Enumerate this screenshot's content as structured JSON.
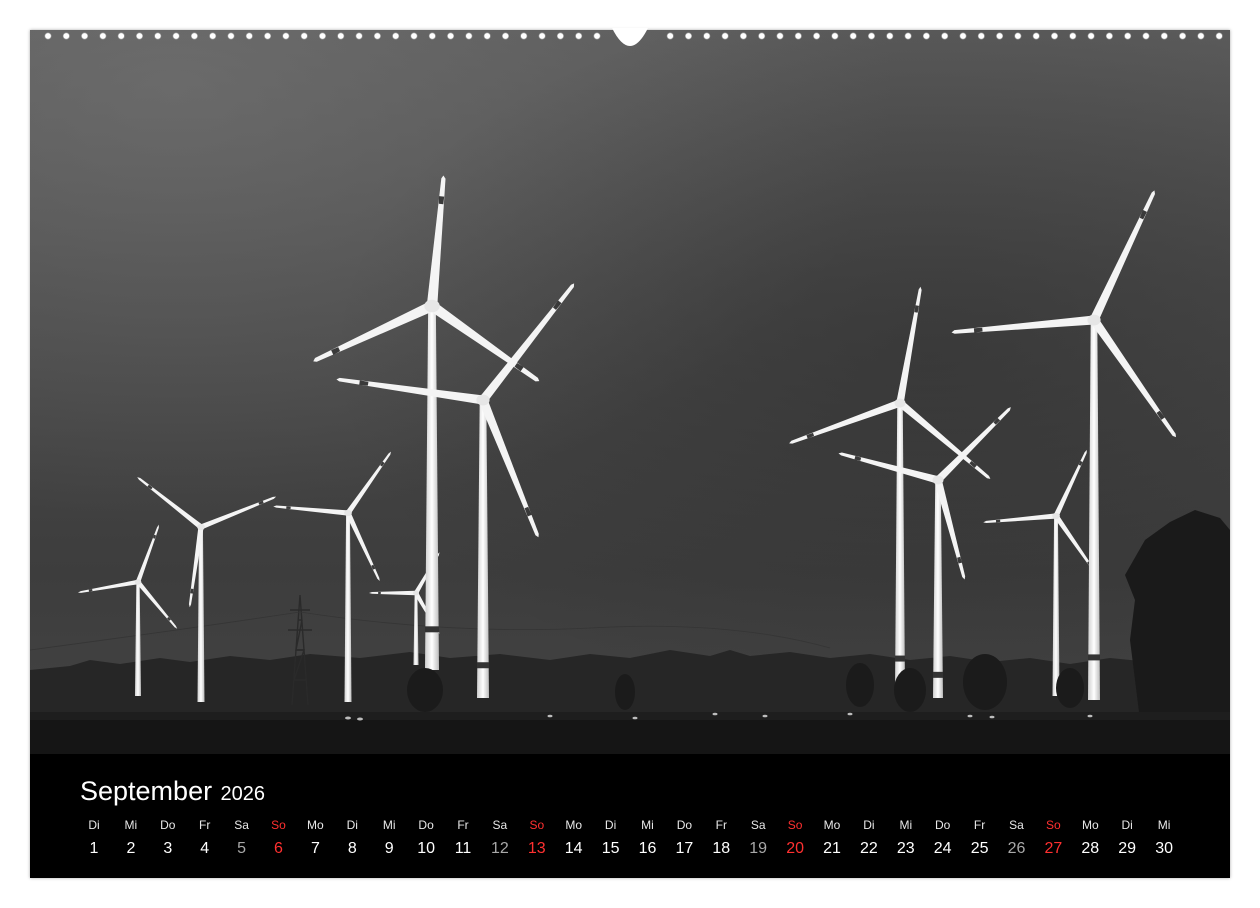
{
  "calendar": {
    "month": "September",
    "year": "2026",
    "colors": {
      "sunday": "#ff3030",
      "saturday": "#a8a8a8",
      "weekday": "#ffffff",
      "background": "#000000"
    },
    "days": [
      {
        "name": "Di",
        "num": "1",
        "type": "weekday"
      },
      {
        "name": "Mi",
        "num": "2",
        "type": "weekday"
      },
      {
        "name": "Do",
        "num": "3",
        "type": "weekday"
      },
      {
        "name": "Fr",
        "num": "4",
        "type": "weekday"
      },
      {
        "name": "Sa",
        "num": "5",
        "type": "saturday"
      },
      {
        "name": "So",
        "num": "6",
        "type": "sunday"
      },
      {
        "name": "Mo",
        "num": "7",
        "type": "weekday"
      },
      {
        "name": "Di",
        "num": "8",
        "type": "weekday"
      },
      {
        "name": "Mi",
        "num": "9",
        "type": "weekday"
      },
      {
        "name": "Do",
        "num": "10",
        "type": "weekday"
      },
      {
        "name": "Fr",
        "num": "11",
        "type": "weekday"
      },
      {
        "name": "Sa",
        "num": "12",
        "type": "saturday"
      },
      {
        "name": "So",
        "num": "13",
        "type": "sunday"
      },
      {
        "name": "Mo",
        "num": "14",
        "type": "weekday"
      },
      {
        "name": "Di",
        "num": "15",
        "type": "weekday"
      },
      {
        "name": "Mi",
        "num": "16",
        "type": "weekday"
      },
      {
        "name": "Do",
        "num": "17",
        "type": "weekday"
      },
      {
        "name": "Fr",
        "num": "18",
        "type": "weekday"
      },
      {
        "name": "Sa",
        "num": "19",
        "type": "saturday"
      },
      {
        "name": "So",
        "num": "20",
        "type": "sunday"
      },
      {
        "name": "Mo",
        "num": "21",
        "type": "weekday"
      },
      {
        "name": "Di",
        "num": "22",
        "type": "weekday"
      },
      {
        "name": "Mi",
        "num": "23",
        "type": "weekday"
      },
      {
        "name": "Do",
        "num": "24",
        "type": "weekday"
      },
      {
        "name": "Fr",
        "num": "25",
        "type": "weekday"
      },
      {
        "name": "Sa",
        "num": "26",
        "type": "saturday"
      },
      {
        "name": "So",
        "num": "27",
        "type": "sunday"
      },
      {
        "name": "Mo",
        "num": "28",
        "type": "weekday"
      },
      {
        "name": "Di",
        "num": "29",
        "type": "weekday"
      },
      {
        "name": "Mi",
        "num": "30",
        "type": "weekday"
      }
    ]
  },
  "photo": {
    "subject": "wind-turbines-black-white",
    "turbine_count": 9
  }
}
